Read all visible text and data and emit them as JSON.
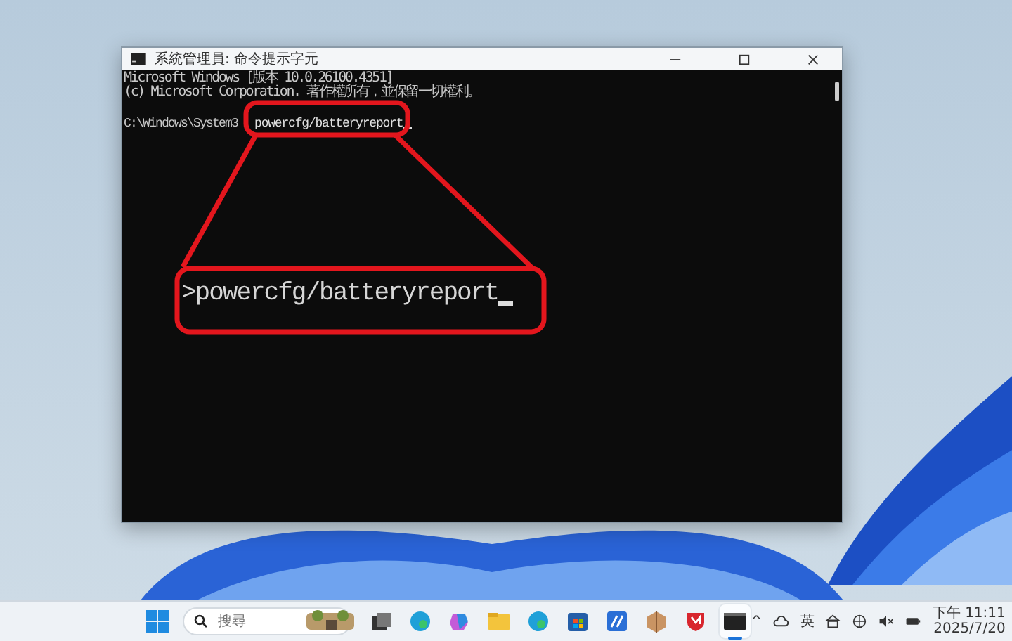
{
  "window": {
    "title": "系統管理員: 命令提示字元"
  },
  "console": {
    "lines": [
      "Microsoft Windows [版本 10.0.26100.4351]",
      "(c) Microsoft Corporation. 著作權所有，並保留一切權利。"
    ],
    "prompt": "C:\\Windows\\System3",
    "command": "powercfg/batteryreport"
  },
  "callout": {
    "text": ">powercfg/batteryreport"
  },
  "taskbar": {
    "search": {
      "placeholder": "搜尋"
    },
    "apps": [
      {
        "kind": "thumbnail",
        "active": false
      },
      {
        "kind": "taskview",
        "active": false
      },
      {
        "kind": "edge",
        "active": false
      },
      {
        "kind": "copilot",
        "active": false
      },
      {
        "kind": "folder",
        "active": false
      },
      {
        "kind": "edge",
        "active": false
      },
      {
        "kind": "store",
        "active": false
      },
      {
        "kind": "pen",
        "active": false
      },
      {
        "kind": "box",
        "active": false
      },
      {
        "kind": "shield",
        "active": false
      },
      {
        "kind": "terminal",
        "active": true
      }
    ],
    "tray": {
      "chevron": "^",
      "ime": "英",
      "clock_time": "下午 11:11",
      "clock_date": "2025/7/20"
    }
  }
}
